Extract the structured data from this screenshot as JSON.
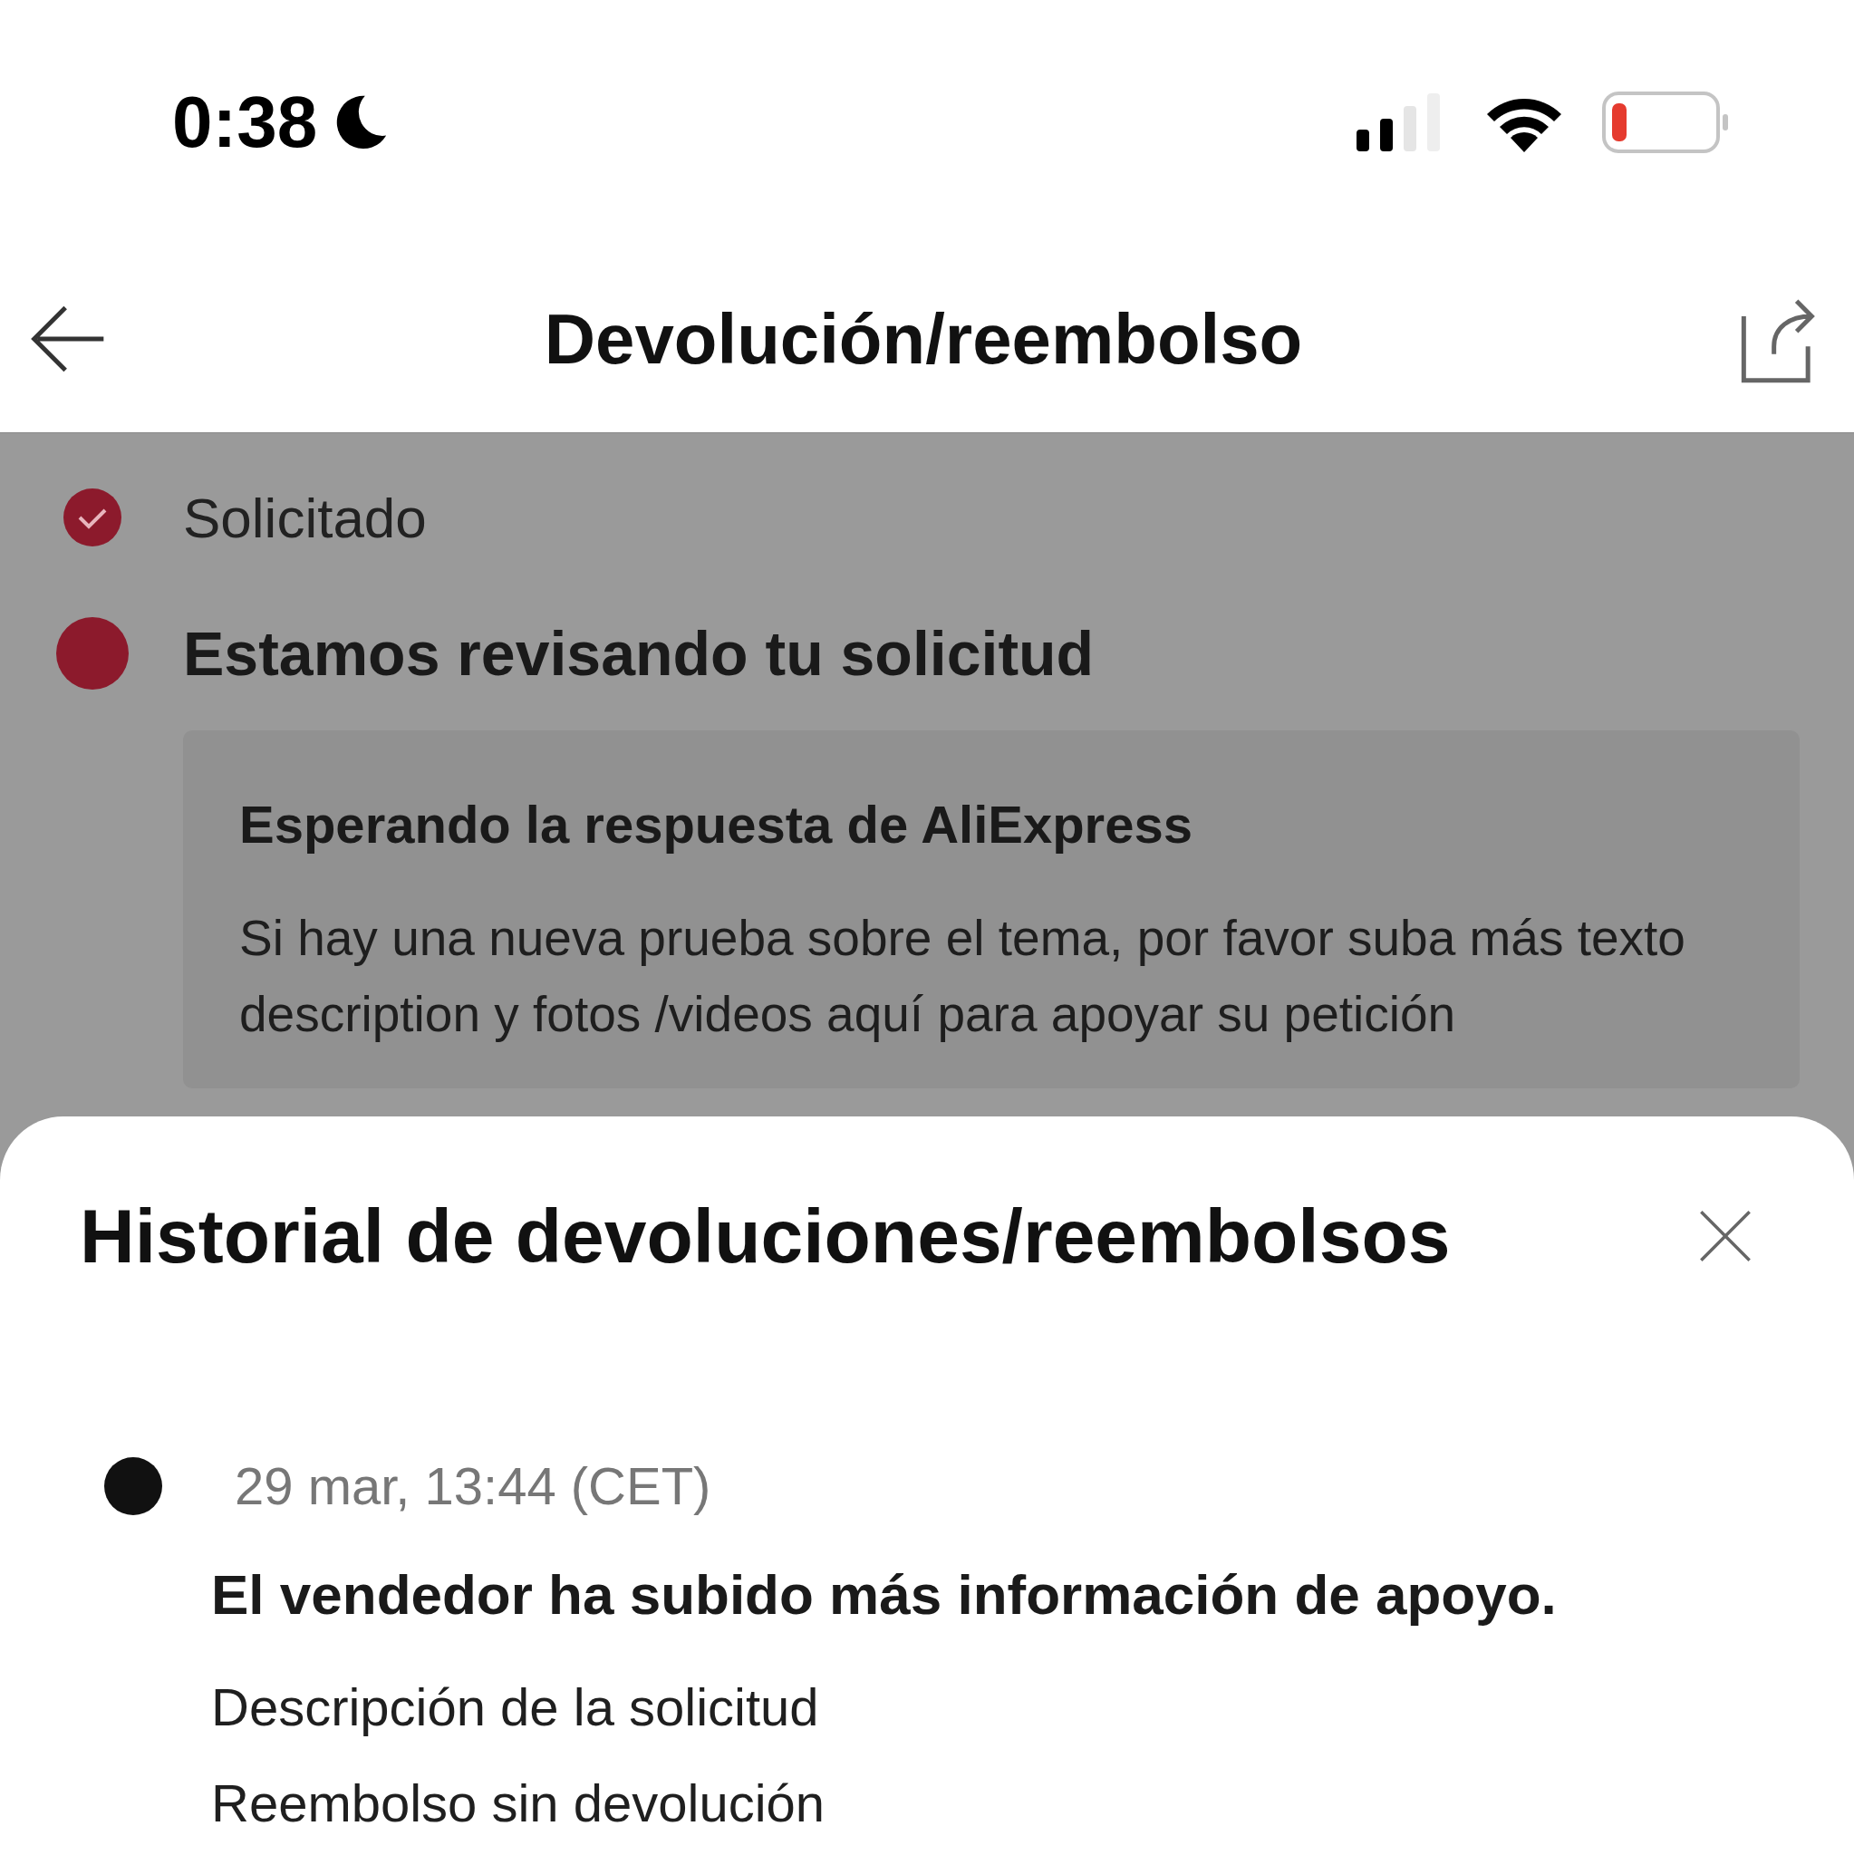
{
  "status_bar": {
    "time": "0:38"
  },
  "header": {
    "title": "Devolución/reembolso"
  },
  "steps": [
    {
      "label": "Solicitado",
      "done": true
    },
    {
      "label": "Estamos revisando tu solicitud",
      "done": false
    }
  ],
  "card": {
    "title": "Esperando la respuesta de AliExpress",
    "body": "Si hay una nueva prueba sobre el tema, por favor suba más texto description y fotos /videos aquí para apoyar su petición"
  },
  "sheet": {
    "title": "Historial de devoluciones/reembolsos",
    "entries": [
      {
        "time": "29 mar, 13:44 (CET)",
        "message": "El vendedor ha subido más información de apoyo.",
        "details": [
          "Descripción de la solicitud",
          "Reembolso sin devolución"
        ]
      }
    ]
  }
}
